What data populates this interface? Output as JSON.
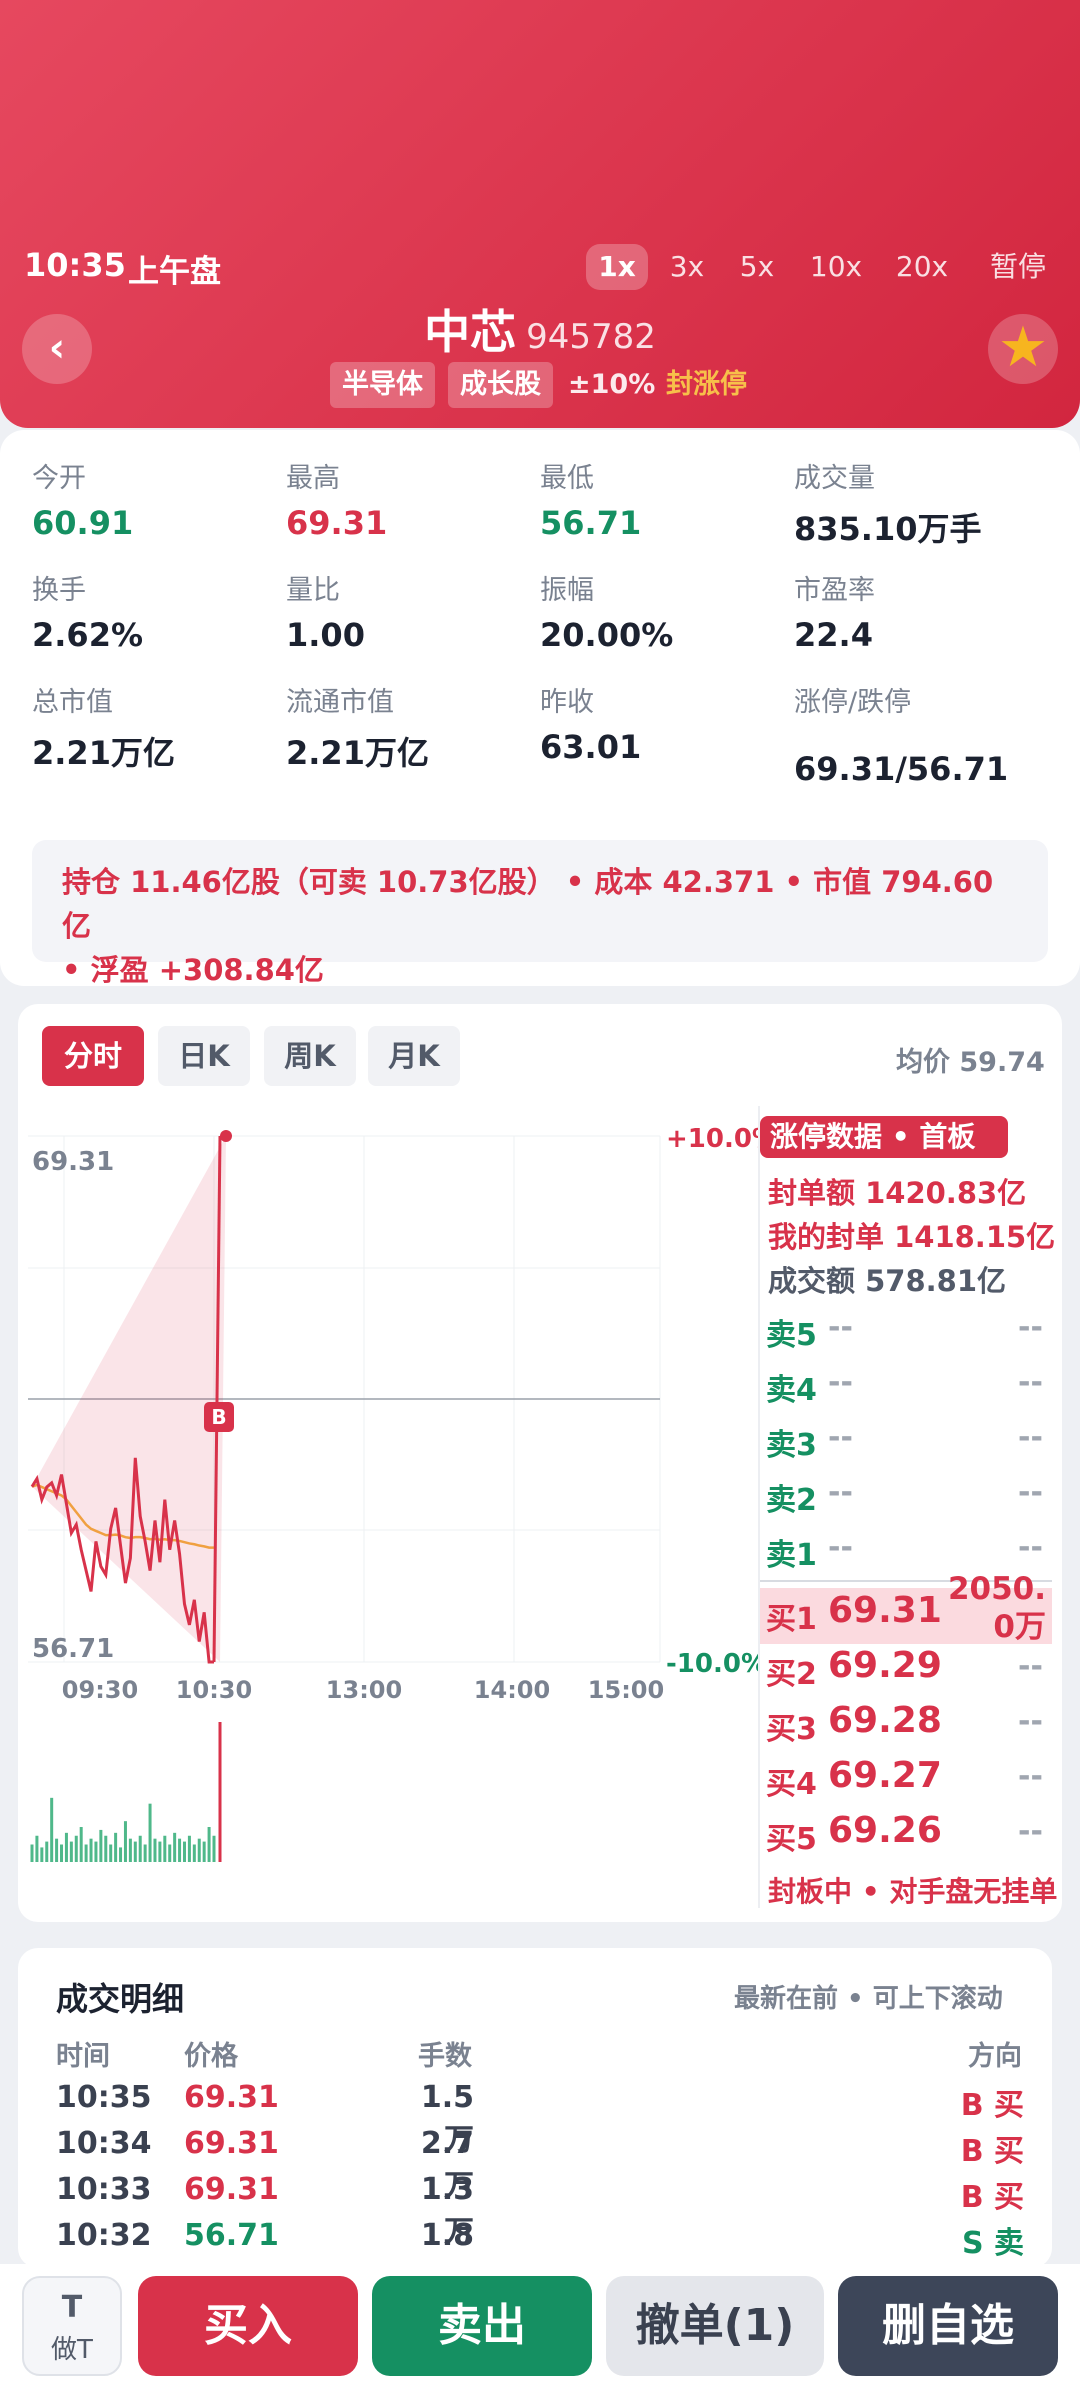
{
  "header": {
    "time": "10:35",
    "session": "上午盘",
    "speeds": [
      "1x",
      "3x",
      "5x",
      "10x",
      "20x",
      "暂停"
    ],
    "stock_name": "中芯",
    "stock_code": "945782",
    "tags": [
      "半导体",
      "成长股"
    ],
    "limit_range": "±10%",
    "limit_status": "封涨停",
    "back_icon": "chevron-left-icon",
    "favorite_icon": "star-icon",
    "colors": {
      "bg_from": "#e6485f",
      "bg_to": "#d2263f",
      "accent": "#f7b51f"
    }
  },
  "stats": [
    {
      "label": "今开",
      "value": "60.91",
      "color": "green"
    },
    {
      "label": "最高",
      "value": "69.31",
      "color": "red"
    },
    {
      "label": "最低",
      "value": "56.71",
      "color": "green"
    },
    {
      "label": "成交量",
      "value": "835.10万手",
      "color": "dark"
    },
    {
      "label": "换手",
      "value": "2.62%",
      "color": "dark"
    },
    {
      "label": "量比",
      "value": "1.00",
      "color": "dark"
    },
    {
      "label": "振幅",
      "value": "20.00%",
      "color": "dark"
    },
    {
      "label": "市盈率",
      "value": "22.4",
      "color": "dark"
    },
    {
      "label": "总市值",
      "value": "2.21万亿",
      "color": "dark"
    },
    {
      "label": "流通市值",
      "value": "2.21万亿",
      "color": "dark"
    },
    {
      "label": "昨收",
      "value": "63.01",
      "color": "dark"
    },
    {
      "label": "涨停/跌停",
      "value": "69.31/56.71",
      "color": "dark"
    }
  ],
  "position": {
    "line1": "持仓 11.46亿股（可卖 10.73亿股） • 成本 42.371 • 市值 794.60亿",
    "line2": "• 浮盈 +308.84亿"
  },
  "chart_tabs": [
    "分时",
    "日K",
    "周K",
    "月K"
  ],
  "avg_price": "均价 59.74",
  "chart_data": {
    "type": "line",
    "y_max_label": "69.31",
    "y_min_label": "56.71",
    "pct_top": "+10.0%",
    "pct_bottom": "-10.0%",
    "x_ticks": [
      "09:30",
      "10:30",
      "13:00",
      "14:00",
      "15:00"
    ],
    "ylim": [
      56.71,
      69.31
    ],
    "prev_close": 63.01,
    "marker": "B",
    "price": [
      60.91,
      61.1,
      60.6,
      60.9,
      61.0,
      60.7,
      61.2,
      60.5,
      59.8,
      60.0,
      59.4,
      58.9,
      58.4,
      59.6,
      59.0,
      58.8,
      59.9,
      60.4,
      59.5,
      58.6,
      59.2,
      61.6,
      60.2,
      59.6,
      58.9,
      60.1,
      59.1,
      60.6,
      59.4,
      60.1,
      59.3,
      58.1,
      57.6,
      58.2,
      57.2,
      57.9,
      56.71,
      56.71,
      69.31
    ],
    "avg": [
      60.91,
      60.95,
      60.9,
      60.85,
      60.8,
      60.75,
      60.7,
      60.6,
      60.45,
      60.3,
      60.15,
      60.0,
      59.9,
      59.85,
      59.8,
      59.75,
      59.75,
      59.76,
      59.74,
      59.7,
      59.68,
      59.7,
      59.7,
      59.68,
      59.65,
      59.66,
      59.64,
      59.65,
      59.63,
      59.63,
      59.61,
      59.58,
      59.55,
      59.53,
      59.5,
      59.48,
      59.45,
      59.45,
      59.74
    ],
    "volume": [
      6,
      9,
      5,
      7,
      22,
      8,
      6,
      10,
      7,
      9,
      12,
      6,
      8,
      7,
      11,
      9,
      6,
      10,
      5,
      14,
      8,
      7,
      9,
      6,
      20,
      8,
      7,
      9,
      6,
      10,
      8,
      7,
      9,
      6,
      8,
      7,
      12,
      9,
      48
    ]
  },
  "orderbook": {
    "title": "涨停数据 • 首板",
    "seal_amount": "封单额 1420.83亿",
    "my_seal": "我的封单 1418.15亿",
    "turnover": "成交额 578.81亿",
    "asks": [
      {
        "label": "卖5",
        "price": "--",
        "vol": "--"
      },
      {
        "label": "卖4",
        "price": "--",
        "vol": "--"
      },
      {
        "label": "卖3",
        "price": "--",
        "vol": "--"
      },
      {
        "label": "卖2",
        "price": "--",
        "vol": "--"
      },
      {
        "label": "卖1",
        "price": "--",
        "vol": "--"
      }
    ],
    "bids": [
      {
        "label": "买1",
        "price": "69.31",
        "vol": "2050.0万"
      },
      {
        "label": "买2",
        "price": "69.29",
        "vol": "--"
      },
      {
        "label": "买3",
        "price": "69.28",
        "vol": "--"
      },
      {
        "label": "买4",
        "price": "69.27",
        "vol": "--"
      },
      {
        "label": "买5",
        "price": "69.26",
        "vol": "--"
      }
    ],
    "footer": "封板中 • 对手盘无挂单"
  },
  "trades": {
    "title": "成交明细",
    "hint": "最新在前 • 可上下滚动",
    "headers": [
      "时间",
      "价格",
      "手数",
      "方向"
    ],
    "rows": [
      {
        "time": "10:35",
        "price": "69.31",
        "qty": "1.5万",
        "dir": "B 买",
        "side": "buy"
      },
      {
        "time": "10:34",
        "price": "69.31",
        "qty": "2.7万",
        "dir": "B 买",
        "side": "buy"
      },
      {
        "time": "10:33",
        "price": "69.31",
        "qty": "1.3万",
        "dir": "B 买",
        "side": "buy"
      },
      {
        "time": "10:32",
        "price": "56.71",
        "qty": "1.8万",
        "dir": "S 卖",
        "side": "sell"
      }
    ]
  },
  "bottom": {
    "t_top": "T",
    "t_bottom": "做T",
    "buy": "买入",
    "sell": "卖出",
    "cancel": "撤单(1)",
    "unfavorite": "删自选"
  }
}
